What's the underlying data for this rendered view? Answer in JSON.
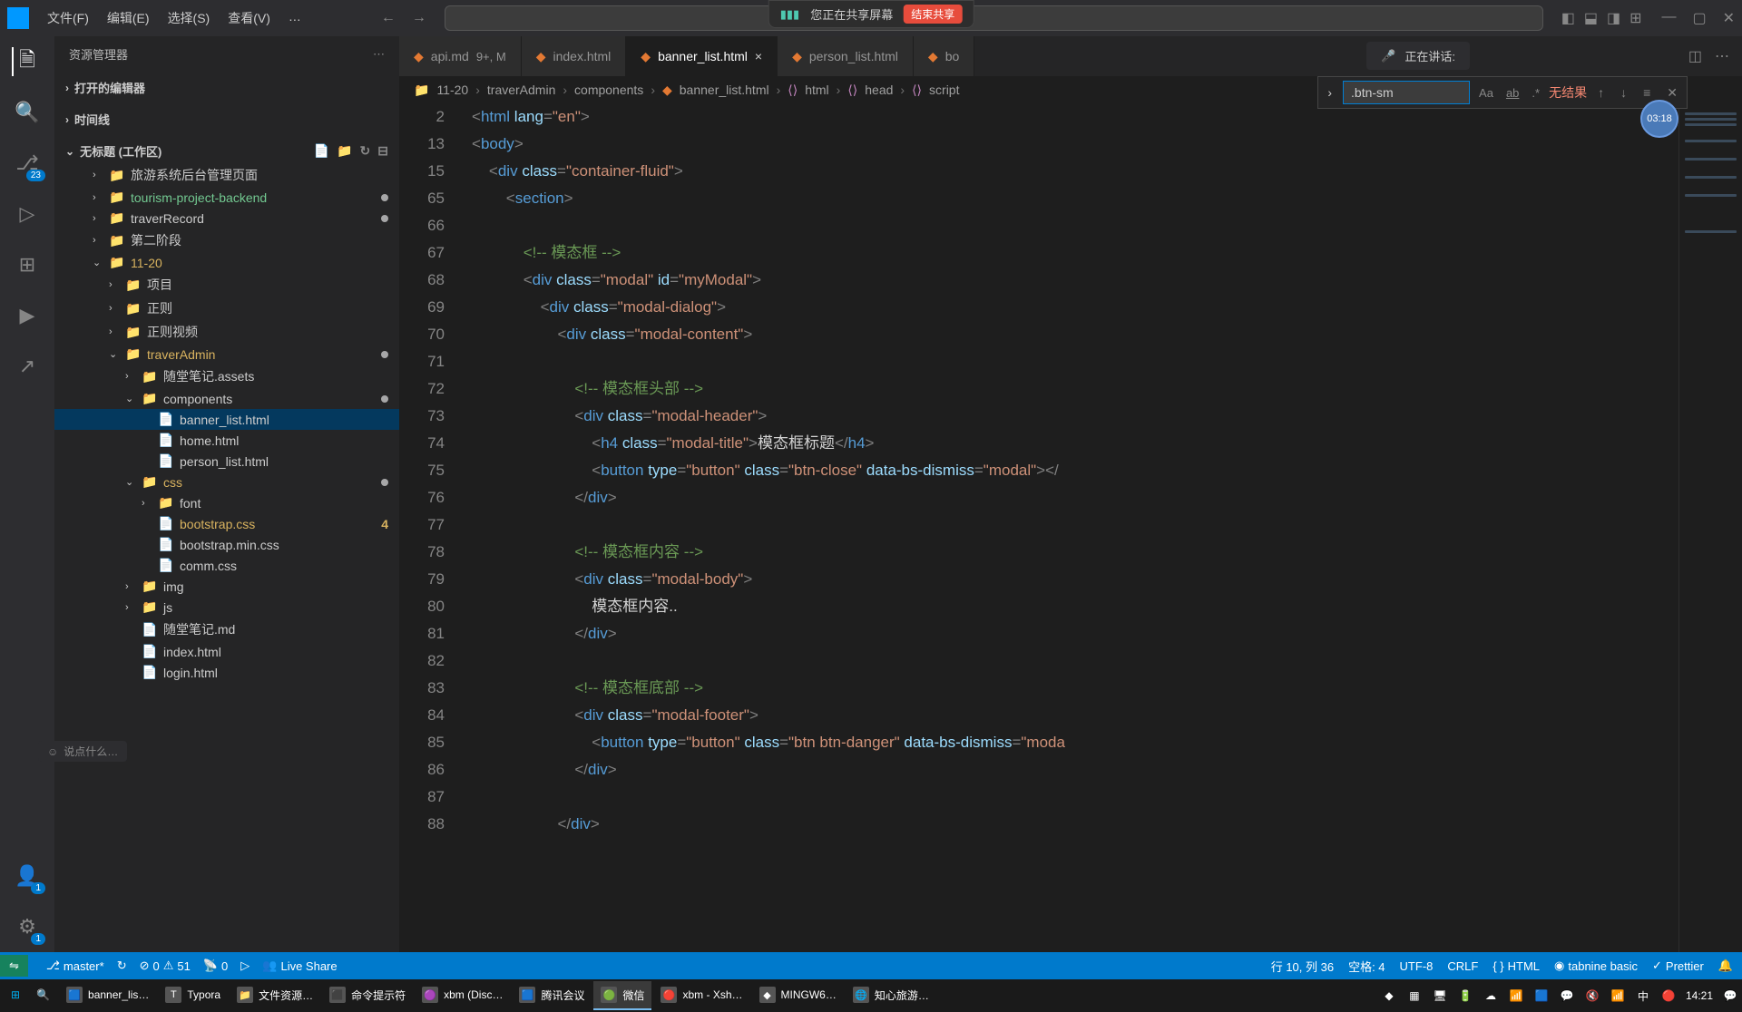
{
  "share": {
    "text": "您正在共享屏幕",
    "end": "结束共享"
  },
  "menu": {
    "file": "文件(F)",
    "edit": "编辑(E)",
    "select": "选择(S)",
    "view": "查看(V)",
    "more": "…"
  },
  "voice": {
    "text": "正在讲话:"
  },
  "sidebar": {
    "title": "资源管理器",
    "opened": "打开的编辑器",
    "timeline": "时间线",
    "workspace": "无标题 (工作区)",
    "tree": [
      {
        "lvl": 2,
        "chev": "›",
        "icon": "📁",
        "name": "旅游系统后台管理页面",
        "cls": ""
      },
      {
        "lvl": 2,
        "chev": "›",
        "icon": "📁",
        "name": "tourism-project-backend",
        "cls": "green",
        "dot": true
      },
      {
        "lvl": 2,
        "chev": "›",
        "icon": "📁",
        "name": "traverRecord",
        "cls": "",
        "dot": true
      },
      {
        "lvl": 2,
        "chev": "›",
        "icon": "📁",
        "name": "第二阶段",
        "cls": ""
      },
      {
        "lvl": 2,
        "chev": "⌄",
        "icon": "📁",
        "name": "11-20",
        "cls": "modified"
      },
      {
        "lvl": 3,
        "chev": "›",
        "icon": "📁",
        "name": "项目",
        "cls": ""
      },
      {
        "lvl": 3,
        "chev": "›",
        "icon": "📁",
        "name": "正则",
        "cls": ""
      },
      {
        "lvl": 3,
        "chev": "›",
        "icon": "📁",
        "name": "正则视频",
        "cls": ""
      },
      {
        "lvl": 3,
        "chev": "⌄",
        "icon": "📁",
        "name": "traverAdmin",
        "cls": "modified",
        "dot": true
      },
      {
        "lvl": 4,
        "chev": "›",
        "icon": "📁",
        "name": "随堂笔记.assets",
        "cls": ""
      },
      {
        "lvl": 4,
        "chev": "⌄",
        "icon": "📁",
        "name": "components",
        "cls": "",
        "dot": true
      },
      {
        "lvl": 5,
        "chev": "",
        "icon": "📄",
        "name": "banner_list.html",
        "cls": "",
        "selected": true
      },
      {
        "lvl": 5,
        "chev": "",
        "icon": "📄",
        "name": "home.html",
        "cls": ""
      },
      {
        "lvl": 5,
        "chev": "",
        "icon": "📄",
        "name": "person_list.html",
        "cls": ""
      },
      {
        "lvl": 4,
        "chev": "⌄",
        "icon": "📁",
        "name": "css",
        "cls": "modified",
        "dot": true
      },
      {
        "lvl": 5,
        "chev": "›",
        "icon": "📁",
        "name": "font",
        "cls": ""
      },
      {
        "lvl": 5,
        "chev": "",
        "icon": "📄",
        "name": "bootstrap.css",
        "cls": "modified",
        "num": "4"
      },
      {
        "lvl": 5,
        "chev": "",
        "icon": "📄",
        "name": "bootstrap.min.css",
        "cls": ""
      },
      {
        "lvl": 5,
        "chev": "",
        "icon": "📄",
        "name": "comm.css",
        "cls": ""
      },
      {
        "lvl": 4,
        "chev": "›",
        "icon": "📁",
        "name": "img",
        "cls": ""
      },
      {
        "lvl": 4,
        "chev": "›",
        "icon": "📁",
        "name": "js",
        "cls": ""
      },
      {
        "lvl": 4,
        "chev": "",
        "icon": "📄",
        "name": "随堂笔记.md",
        "cls": ""
      },
      {
        "lvl": 4,
        "chev": "",
        "icon": "📄",
        "name": "index.html",
        "cls": ""
      },
      {
        "lvl": 4,
        "chev": "",
        "icon": "📄",
        "name": "login.html",
        "cls": ""
      }
    ]
  },
  "activity": {
    "scm_badge": "23",
    "account_badge": "1",
    "gear_badge": "1"
  },
  "tabs": [
    {
      "name": "api.md",
      "status": "9+, M",
      "active": false
    },
    {
      "name": "index.html",
      "status": "",
      "active": false
    },
    {
      "name": "banner_list.html",
      "status": "",
      "active": true,
      "close": "×"
    },
    {
      "name": "person_list.html",
      "status": "",
      "active": false
    },
    {
      "name": "bo",
      "status": "",
      "active": false,
      "cut": true
    }
  ],
  "breadcrumb": [
    "11-20",
    "traverAdmin",
    "components",
    "banner_list.html",
    "html",
    "head",
    "script"
  ],
  "find": {
    "value": ".btn-sm",
    "result": "无结果"
  },
  "timer": "03:18",
  "comment_input": "说点什么…",
  "lines": [
    {
      "n": 2,
      "html": "<span class='punct'>&lt;</span><span class='tag'>html</span> <span class='attr'>lang</span><span class='punct'>=</span><span class='str'>\"en\"</span><span class='punct'>&gt;</span>"
    },
    {
      "n": 13,
      "html": "<span class='punct'>&lt;</span><span class='tag'>body</span><span class='punct'>&gt;</span>"
    },
    {
      "n": 15,
      "html": "    <span class='punct'>&lt;</span><span class='tag'>div</span> <span class='attr'>class</span><span class='punct'>=</span><span class='str'>\"container-fluid\"</span><span class='punct'>&gt;</span>"
    },
    {
      "n": 65,
      "html": "        <span class='punct'>&lt;</span><span class='tag'>section</span><span class='punct'>&gt;</span>"
    },
    {
      "n": 66,
      "html": ""
    },
    {
      "n": 67,
      "html": "            <span class='comment'>&lt;!-- 模态框 --&gt;</span>"
    },
    {
      "n": 68,
      "html": "            <span class='punct'>&lt;</span><span class='tag'>div</span> <span class='attr'>class</span><span class='punct'>=</span><span class='str'>\"modal\"</span> <span class='attr'>id</span><span class='punct'>=</span><span class='str'>\"myModal\"</span><span class='punct'>&gt;</span>"
    },
    {
      "n": 69,
      "html": "                <span class='punct'>&lt;</span><span class='tag'>div</span> <span class='attr'>class</span><span class='punct'>=</span><span class='str'>\"modal-dialog\"</span><span class='punct'>&gt;</span>"
    },
    {
      "n": 70,
      "html": "                    <span class='punct'>&lt;</span><span class='tag'>div</span> <span class='attr'>class</span><span class='punct'>=</span><span class='str'>\"modal-content\"</span><span class='punct'>&gt;</span>"
    },
    {
      "n": 71,
      "html": ""
    },
    {
      "n": 72,
      "html": "                        <span class='comment'>&lt;!-- 模态框头部 --&gt;</span>"
    },
    {
      "n": 73,
      "html": "                        <span class='punct'>&lt;</span><span class='tag'>div</span> <span class='attr'>class</span><span class='punct'>=</span><span class='str'>\"modal-header\"</span><span class='punct'>&gt;</span>"
    },
    {
      "n": 74,
      "html": "                            <span class='punct'>&lt;</span><span class='tag'>h4</span> <span class='attr'>class</span><span class='punct'>=</span><span class='str'>\"modal-title\"</span><span class='punct'>&gt;</span><span class='text'>模态框标题</span><span class='punct'>&lt;/</span><span class='tag'>h4</span><span class='punct'>&gt;</span>"
    },
    {
      "n": 75,
      "html": "                            <span class='punct'>&lt;</span><span class='tag'>button</span> <span class='attr'>type</span><span class='punct'>=</span><span class='str'>\"button\"</span> <span class='attr'>class</span><span class='punct'>=</span><span class='str'>\"btn-close\"</span> <span class='attr'>data-bs-dismiss</span><span class='punct'>=</span><span class='str'>\"modal\"</span><span class='punct'>&gt;&lt;/</span>"
    },
    {
      "n": 76,
      "html": "                        <span class='punct'>&lt;/</span><span class='tag'>div</span><span class='punct'>&gt;</span>"
    },
    {
      "n": 77,
      "html": ""
    },
    {
      "n": 78,
      "html": "                        <span class='comment'>&lt;!-- 模态框内容 --&gt;</span>"
    },
    {
      "n": 79,
      "html": "                        <span class='punct'>&lt;</span><span class='tag'>div</span> <span class='attr'>class</span><span class='punct'>=</span><span class='str'>\"modal-body\"</span><span class='punct'>&gt;</span>"
    },
    {
      "n": 80,
      "html": "                            <span class='text'>模态框内容..</span>"
    },
    {
      "n": 81,
      "html": "                        <span class='punct'>&lt;/</span><span class='tag'>div</span><span class='punct'>&gt;</span>"
    },
    {
      "n": 82,
      "html": ""
    },
    {
      "n": 83,
      "html": "                        <span class='comment'>&lt;!-- 模态框底部 --&gt;</span>"
    },
    {
      "n": 84,
      "html": "                        <span class='punct'>&lt;</span><span class='tag'>div</span> <span class='attr'>class</span><span class='punct'>=</span><span class='str'>\"modal-footer\"</span><span class='punct'>&gt;</span>"
    },
    {
      "n": 85,
      "html": "                            <span class='punct'>&lt;</span><span class='tag'>button</span> <span class='attr'>type</span><span class='punct'>=</span><span class='str'>\"button\"</span> <span class='attr'>class</span><span class='punct'>=</span><span class='str'>\"btn btn-danger\"</span> <span class='attr'>data-bs-dismiss</span><span class='punct'>=</span><span class='str'>\"moda</span>"
    },
    {
      "n": 86,
      "html": "                        <span class='punct'>&lt;/</span><span class='tag'>div</span><span class='punct'>&gt;</span>"
    },
    {
      "n": 87,
      "html": ""
    },
    {
      "n": 88,
      "html": "                    <span class='punct'>&lt;/</span><span class='tag'>div</span><span class='punct'>&gt;</span>"
    }
  ],
  "status": {
    "branch": "master*",
    "errors": "0",
    "warnings": "51",
    "port": "0",
    "live": "Live Share",
    "cursor": "行 10, 列 36",
    "spaces": "空格: 4",
    "encoding": "UTF-8",
    "eol": "CRLF",
    "lang": "HTML",
    "tabnine": "tabnine basic",
    "prettier": "Prettier"
  },
  "taskbar": {
    "items": [
      {
        "label": "banner_lis…",
        "icon": "🟦"
      },
      {
        "label": "Typora",
        "icon": "T"
      },
      {
        "label": "文件资源…",
        "icon": "📁"
      },
      {
        "label": "命令提示符",
        "icon": "⬛"
      },
      {
        "label": "xbm (Disc…",
        "icon": "🟣"
      },
      {
        "label": "腾讯会议",
        "icon": "🟦"
      },
      {
        "label": "微信",
        "icon": "🟢",
        "active": true
      },
      {
        "label": "xbm - Xsh…",
        "icon": "🔴"
      },
      {
        "label": "MINGW6…",
        "icon": "◆"
      },
      {
        "label": "知心旅游…",
        "icon": "🌐"
      }
    ],
    "time": "14:21"
  }
}
